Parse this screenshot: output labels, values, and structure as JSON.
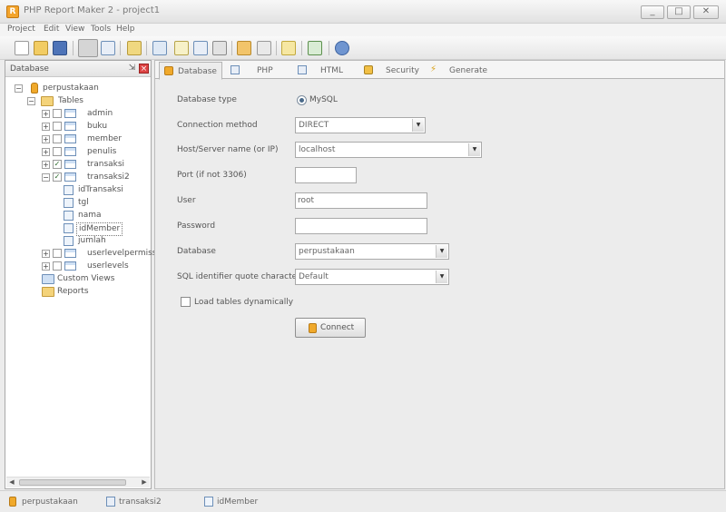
{
  "window": {
    "title": "PHP Report Maker 2 - project1",
    "minimize": "_",
    "maximize": "□",
    "close": "✕"
  },
  "menu": [
    "Project",
    "Edit",
    "View",
    "Tools",
    "Help"
  ],
  "toolbar": {
    "buttons": [
      "new-file-icon",
      "open-folder-icon",
      "save-icon",
      "database-tree-icon",
      "table-view-icon",
      "report-icon",
      "chart-icon",
      "crosstab-icon",
      "edit-icon",
      "wizard-icon",
      "run-icon",
      "link-icon",
      "generate-icon",
      "export-icon",
      "help-icon"
    ]
  },
  "left_panel": {
    "title": "Database",
    "pin_icon": "pin-icon",
    "close_icon": "close-icon",
    "tree": {
      "db": "perpustakaan",
      "tables_label": "Tables",
      "tables": [
        {
          "label": "admin",
          "checked": false,
          "expanded": false
        },
        {
          "label": "buku",
          "checked": false,
          "expanded": false
        },
        {
          "label": "member",
          "checked": false,
          "expanded": false
        },
        {
          "label": "penulis",
          "checked": false,
          "expanded": false
        },
        {
          "label": "transaksi",
          "checked": true,
          "expanded": false
        },
        {
          "label": "transaksi2",
          "checked": true,
          "expanded": true
        }
      ],
      "fields": [
        "idTransaksi",
        "tgl",
        "nama",
        "idMember",
        "jumlah"
      ],
      "selected_field": "idMember",
      "more_tables": [
        "userlevelpermissions",
        "userlevels"
      ],
      "custom_views": "Custom Views",
      "reports": "Reports"
    }
  },
  "tabs": [
    {
      "label": "Database",
      "icon": "database-icon",
      "active": true
    },
    {
      "label": "PHP",
      "icon": "php-icon",
      "active": false
    },
    {
      "label": "HTML",
      "icon": "html-icon",
      "active": false
    },
    {
      "label": "Security",
      "icon": "lock-icon",
      "active": false
    },
    {
      "label": "Generate",
      "icon": "lightning-icon",
      "active": false
    }
  ],
  "form": {
    "db_type_label": "Database type",
    "db_type_value": "MySQL",
    "conn_method_label": "Connection method",
    "conn_method_value": "DIRECT",
    "host_label": "Host/Server name (or IP)",
    "host_value": "localhost",
    "port_label": "Port (if not 3306)",
    "port_value": "",
    "user_label": "User",
    "user_value": "root",
    "password_label": "Password",
    "password_value": "",
    "database_label": "Database",
    "database_value": "perpustakaan",
    "quote_label": "SQL identifier quote character",
    "quote_value": "Default",
    "load_dyn_label": "Load tables dynamically",
    "connect_label": "Connect"
  },
  "status": [
    {
      "label": "perpustakaan",
      "icon": "database-icon"
    },
    {
      "label": "transaksi2",
      "icon": "table-icon"
    },
    {
      "label": "idMember",
      "icon": "field-icon"
    }
  ],
  "colors": {
    "accent": "#f0a92b",
    "table_icon": "#6d8fb8",
    "folder": "#f4d37a"
  }
}
